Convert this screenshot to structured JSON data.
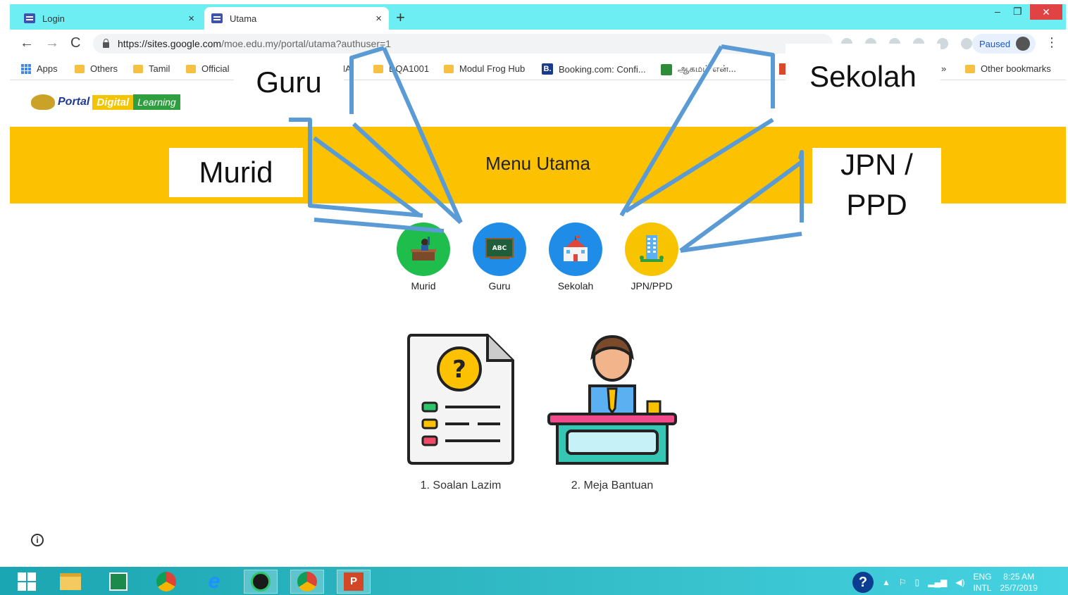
{
  "browser": {
    "tabs": [
      {
        "title": "Login",
        "close": "×"
      },
      {
        "title": "Utama",
        "close": "×"
      }
    ],
    "new_tab": "+",
    "window_controls": {
      "minimize": "–",
      "maximize": "❐",
      "close": "✕"
    },
    "nav": {
      "back": "←",
      "forward": "→",
      "reload": "C"
    },
    "url": {
      "host": "https://sites.google.com",
      "path": "/moe.edu.my/portal/utama?authuser=1"
    },
    "profile": {
      "label": "Paused"
    },
    "menu": "⋮"
  },
  "bookmarks": {
    "apps": "Apps",
    "items": [
      "Others",
      "Tamil",
      "Official",
      "KNA",
      "DQA1001",
      "Modul Frog Hub",
      "Booking.com: Confi...",
      "ஆகமம் என்..."
    ],
    "overflow": "»",
    "other": "Other bookmarks"
  },
  "page": {
    "logo": {
      "portal": "Portal",
      "digital": "Digital",
      "learning": "Learning"
    },
    "banner_title": "Menu Utama",
    "roles": [
      {
        "label": "Murid",
        "icon": "student-desk-icon"
      },
      {
        "label": "Guru",
        "icon": "chalkboard-abc-icon"
      },
      {
        "label": "Sekolah",
        "icon": "school-building-icon"
      },
      {
        "label": "JPN/PPD",
        "icon": "office-building-icon"
      }
    ],
    "resources": [
      {
        "label": "1. Soalan Lazim",
        "icon": "faq-document-icon"
      },
      {
        "label": "2. Meja Bantuan",
        "icon": "help-desk-icon"
      }
    ],
    "info": "i"
  },
  "annotations": {
    "guru": "Guru",
    "murid": "Murid",
    "sekolah": "Sekolah",
    "jpn_line1": "JPN /",
    "jpn_line2": "PPD",
    "arrow_color": "#5b9bd5"
  },
  "taskbar": {
    "help": "?",
    "lang_top": "ENG",
    "lang_bottom": "INTL",
    "time": "8:25 AM",
    "date": "25/7/2019"
  },
  "colors": {
    "banner": "#fcc100",
    "tab_strip": "#6ceef3",
    "murid": "#1fbd4c",
    "guru": "#1f8de8",
    "sekolah": "#1f8de8",
    "jpn": "#f8c300"
  }
}
